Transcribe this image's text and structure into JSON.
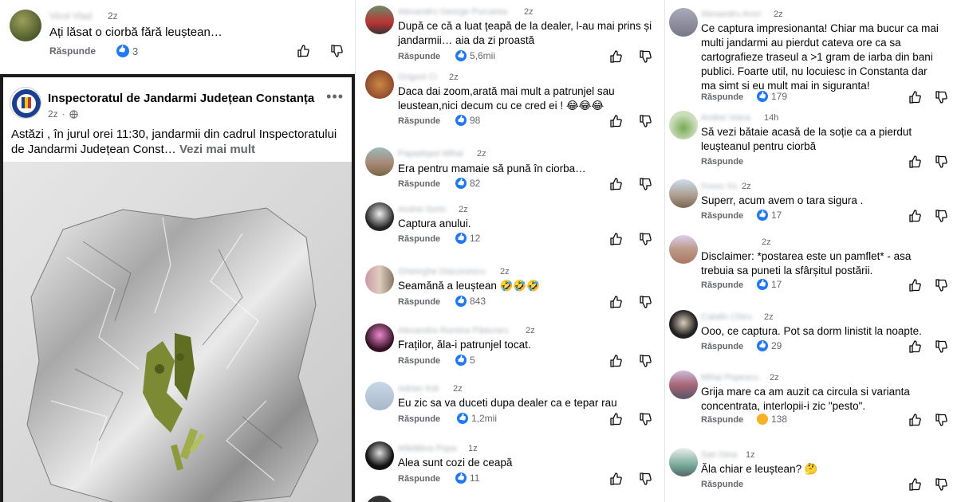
{
  "col1": {
    "top_comment": {
      "name": "Vicol Vlad",
      "time": "2z",
      "text": "Ați lăsat o ciorbă fără leuștean…",
      "reply": "Răspunde",
      "likes": "3"
    },
    "post": {
      "page_name": "Inspectoratul de Jandarmi Județean Constanța",
      "time": "2z",
      "text": "Astăzi , în jurul orei 11:30, jandarmii din cadrul Inspectoratului de Jandarmi Județean Const…",
      "see_more": "Vezi mai mult",
      "menu": "•••"
    }
  },
  "col2": [
    {
      "name": "Alexandru George Purcarea",
      "time": "2z",
      "text": "După ce că a luat țeapă de la dealer, l-au mai prins și jandarmii… aia da zi proastă",
      "reply": "Răspunde",
      "likes": "5,6mii"
    },
    {
      "name": "Grigorii Ci",
      "time": "2z",
      "text": "Daca dai zoom,arată mai mult a patrunjel sau leustean,nici decum cu ce cred ei ! 😂😂😂",
      "reply": "Răspunde",
      "likes": "98"
    },
    {
      "name": "Papadopol Mihai",
      "time": "2z",
      "text": "Era pentru mamaie să pună în ciorba…",
      "reply": "Răspunde",
      "likes": "82"
    },
    {
      "name": "Andrei Sorin",
      "time": "2z",
      "text": "Captura anului.",
      "reply": "Răspunde",
      "likes": "12"
    },
    {
      "name": "Gheorghe Diaconescu",
      "time": "2z",
      "text": "Seamănă a leuștean 🤣🤣🤣",
      "reply": "Răspunde",
      "likes": "843"
    },
    {
      "name": "Alexandra Romina Păduraru",
      "time": "2z",
      "text": "Fraților, ăla-i patrunjel tocat.",
      "reply": "Răspunde",
      "likes": "5"
    },
    {
      "name": "Adrian Kdr",
      "time": "2z",
      "text": "Eu zic sa va duceti dupa dealer ca e tepar rau",
      "reply": "Răspunde",
      "likes": "1,2mii"
    },
    {
      "name": "Mădălina Popa",
      "time": "1z",
      "text": "Alea sunt cozi de ceapă",
      "reply": "Răspunde",
      "likes": "11"
    }
  ],
  "col3": [
    {
      "name": "Alexandru Aron",
      "time": "2z",
      "text": "Ce captura impresionanta! Chiar ma bucur ca mai multi jandarmi au pierdut cateva ore ca sa cartografieze traseul a >1 gram de iarba din bani publici. Foarte util, nu locuiesc in Constanta dar ma simt si eu mult mai in siguranta!",
      "reply": "Răspunde",
      "likes": "179"
    },
    {
      "name": "Andrei Voica",
      "time": "14h",
      "text": "Să vezi bătaie acasă de la soție ca a pierdut leușteanul pentru ciorbă",
      "reply": "Răspunde",
      "likes": ""
    },
    {
      "name": "Xxxxx Xx",
      "time": "2z",
      "text": "Superr, acum avem o tara sigura .",
      "reply": "Răspunde",
      "likes": "17"
    },
    {
      "name": "",
      "time": "2z",
      "text": "Disclaimer: *postarea este un pamflet* - asa trebuia sa puneti la sfârșitul postării.",
      "reply": "Răspunde",
      "likes": "17"
    },
    {
      "name": "Catalin Chiru",
      "time": "2z",
      "text": "Ooo, ce captura. Pot sa dorm linistit la noapte.",
      "reply": "Răspunde",
      "likes": "29"
    },
    {
      "name": "Mihai Popescu",
      "time": "2z",
      "text": "Grija mare ca am auzit ca circula si varianta concentrata, interlopii-i zic \"pesto\".",
      "reply": "Răspunde",
      "likes": "138"
    },
    {
      "name": "San Dina",
      "time": "1z",
      "text": "Ăla chiar e leuștean? 🤔",
      "reply": "Răspunde",
      "likes": ""
    }
  ],
  "colors": {
    "accent": "#2078f4",
    "muted": "#65676b",
    "haha": "#f7b125"
  }
}
